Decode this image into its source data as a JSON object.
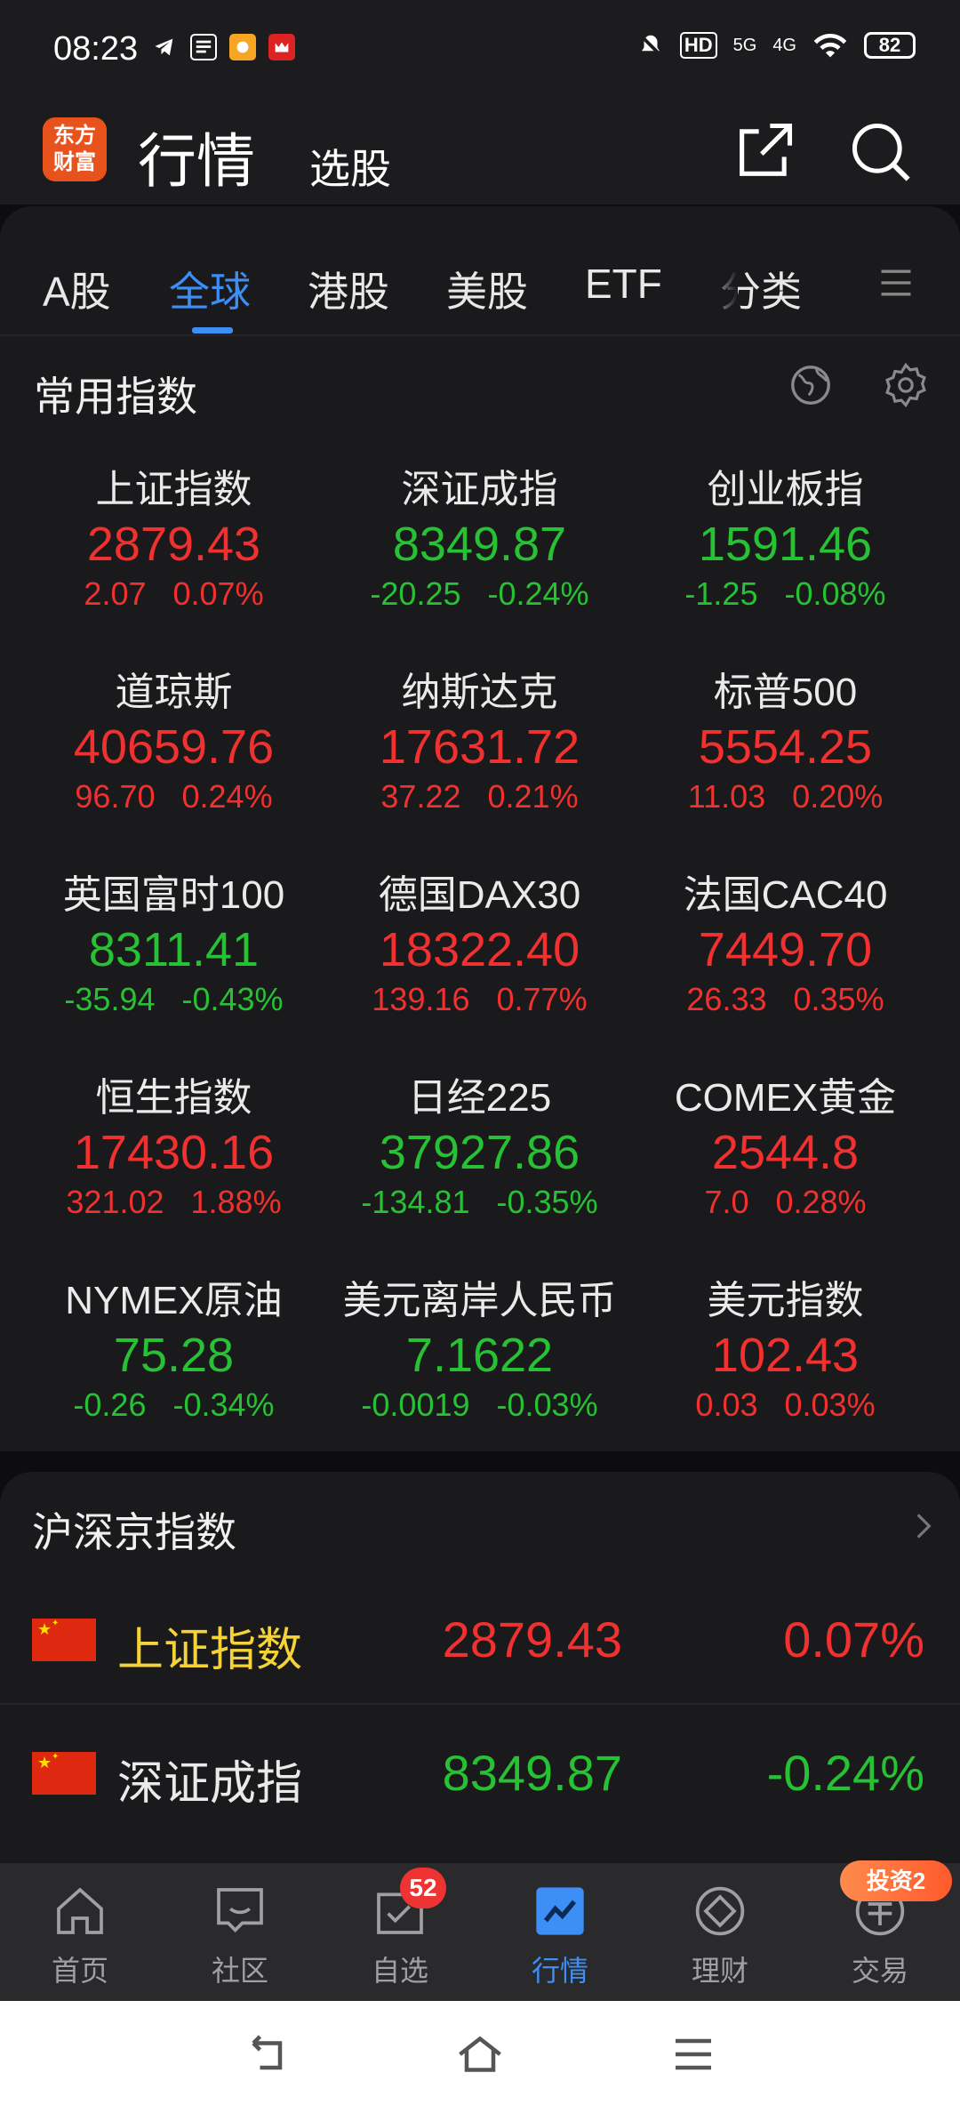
{
  "status_bar": {
    "time": "08:23",
    "left_icons": [
      "telegram-icon",
      "toutiao-icon",
      "app-icon",
      "china-merchants-icon"
    ],
    "right_labels": [
      "HD",
      "5G",
      "4G"
    ],
    "battery": "82"
  },
  "header": {
    "logo_line1": "东方",
    "logo_line2": "财富",
    "title": "行情",
    "subtitle": "选股",
    "icons": [
      "share-icon",
      "search-icon"
    ]
  },
  "tabs": {
    "items": [
      "A股",
      "全球",
      "港股",
      "美股",
      "ETF",
      "分类"
    ],
    "active": "全球",
    "menu_icon": "menu-icon"
  },
  "common_indices": {
    "title": "常用指数",
    "icons": [
      "globe-icon",
      "settings-icon"
    ],
    "items": [
      {
        "name": "上证指数",
        "price": "2879.43",
        "change": "2.07",
        "pct": "0.07%",
        "dir": "up"
      },
      {
        "name": "深证成指",
        "price": "8349.87",
        "change": "-20.25",
        "pct": "-0.24%",
        "dir": "down"
      },
      {
        "name": "创业板指",
        "price": "1591.46",
        "change": "-1.25",
        "pct": "-0.08%",
        "dir": "down"
      },
      {
        "name": "道琼斯",
        "price": "40659.76",
        "change": "96.70",
        "pct": "0.24%",
        "dir": "up"
      },
      {
        "name": "纳斯达克",
        "price": "17631.72",
        "change": "37.22",
        "pct": "0.21%",
        "dir": "up"
      },
      {
        "name": "标普500",
        "price": "5554.25",
        "change": "11.03",
        "pct": "0.20%",
        "dir": "up"
      },
      {
        "name": "英国富时100",
        "price": "8311.41",
        "change": "-35.94",
        "pct": "-0.43%",
        "dir": "down"
      },
      {
        "name": "德国DAX30",
        "price": "18322.40",
        "change": "139.16",
        "pct": "0.77%",
        "dir": "up"
      },
      {
        "name": "法国CAC40",
        "price": "7449.70",
        "change": "26.33",
        "pct": "0.35%",
        "dir": "up"
      },
      {
        "name": "恒生指数",
        "price": "17430.16",
        "change": "321.02",
        "pct": "1.88%",
        "dir": "up"
      },
      {
        "name": "日经225",
        "price": "37927.86",
        "change": "-134.81",
        "pct": "-0.35%",
        "dir": "down"
      },
      {
        "name": "COMEX黄金",
        "price": "2544.8",
        "change": "7.0",
        "pct": "0.28%",
        "dir": "up"
      },
      {
        "name": "NYMEX原油",
        "price": "75.28",
        "change": "-0.26",
        "pct": "-0.34%",
        "dir": "down"
      },
      {
        "name": "美元离岸人民币",
        "price": "7.1622",
        "change": "-0.0019",
        "pct": "-0.03%",
        "dir": "down"
      },
      {
        "name": "美元指数",
        "price": "102.43",
        "change": "0.03",
        "pct": "0.03%",
        "dir": "up"
      }
    ]
  },
  "hsj_indices": {
    "title": "沪深京指数",
    "rows": [
      {
        "name": "上证指数",
        "price": "2879.43",
        "pct": "0.07%",
        "dir": "up",
        "highlight": true
      },
      {
        "name": "深证成指",
        "price": "8349.87",
        "pct": "-0.24%",
        "dir": "down",
        "highlight": false
      }
    ]
  },
  "bottom_nav": {
    "items": [
      "首页",
      "社区",
      "自选",
      "行情",
      "理财",
      "交易"
    ],
    "active": "行情",
    "badge": "52",
    "promo": "投资2"
  },
  "colors": {
    "up": "#f0312f",
    "down": "#27c134",
    "accent": "#3d8ef5",
    "highlight_name": "#f5d235",
    "logo": "#e8531d"
  }
}
